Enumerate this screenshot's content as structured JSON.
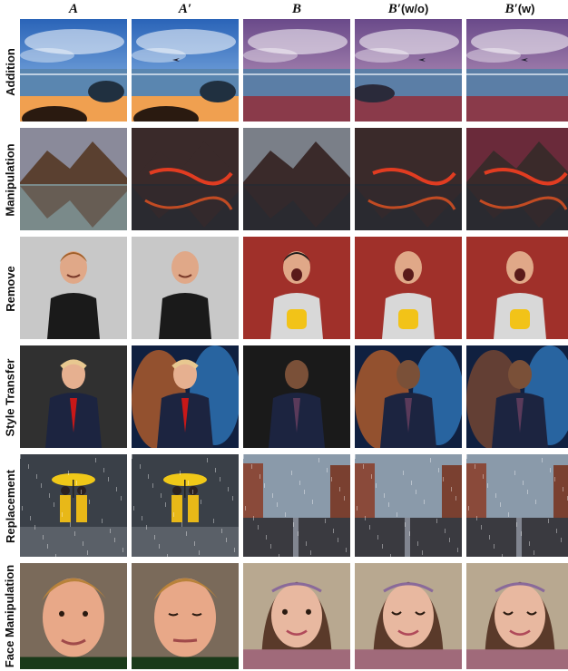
{
  "figure": {
    "columns": [
      {
        "main": "A",
        "suffix": ""
      },
      {
        "main": "A′",
        "suffix": ""
      },
      {
        "main": "B",
        "suffix": ""
      },
      {
        "main": "B′",
        "suffix": "(w/o)"
      },
      {
        "main": "B′",
        "suffix": "(w)"
      }
    ],
    "rows": [
      {
        "label": "Addition",
        "scene": "beach"
      },
      {
        "label": "Manipulation",
        "scene": "mountain"
      },
      {
        "label": "Remove",
        "scene": "person"
      },
      {
        "label": "Style Transfer",
        "scene": "suit"
      },
      {
        "label": "Replacement",
        "scene": "rain"
      },
      {
        "label": "Face Manipulation",
        "scene": "face"
      }
    ]
  }
}
